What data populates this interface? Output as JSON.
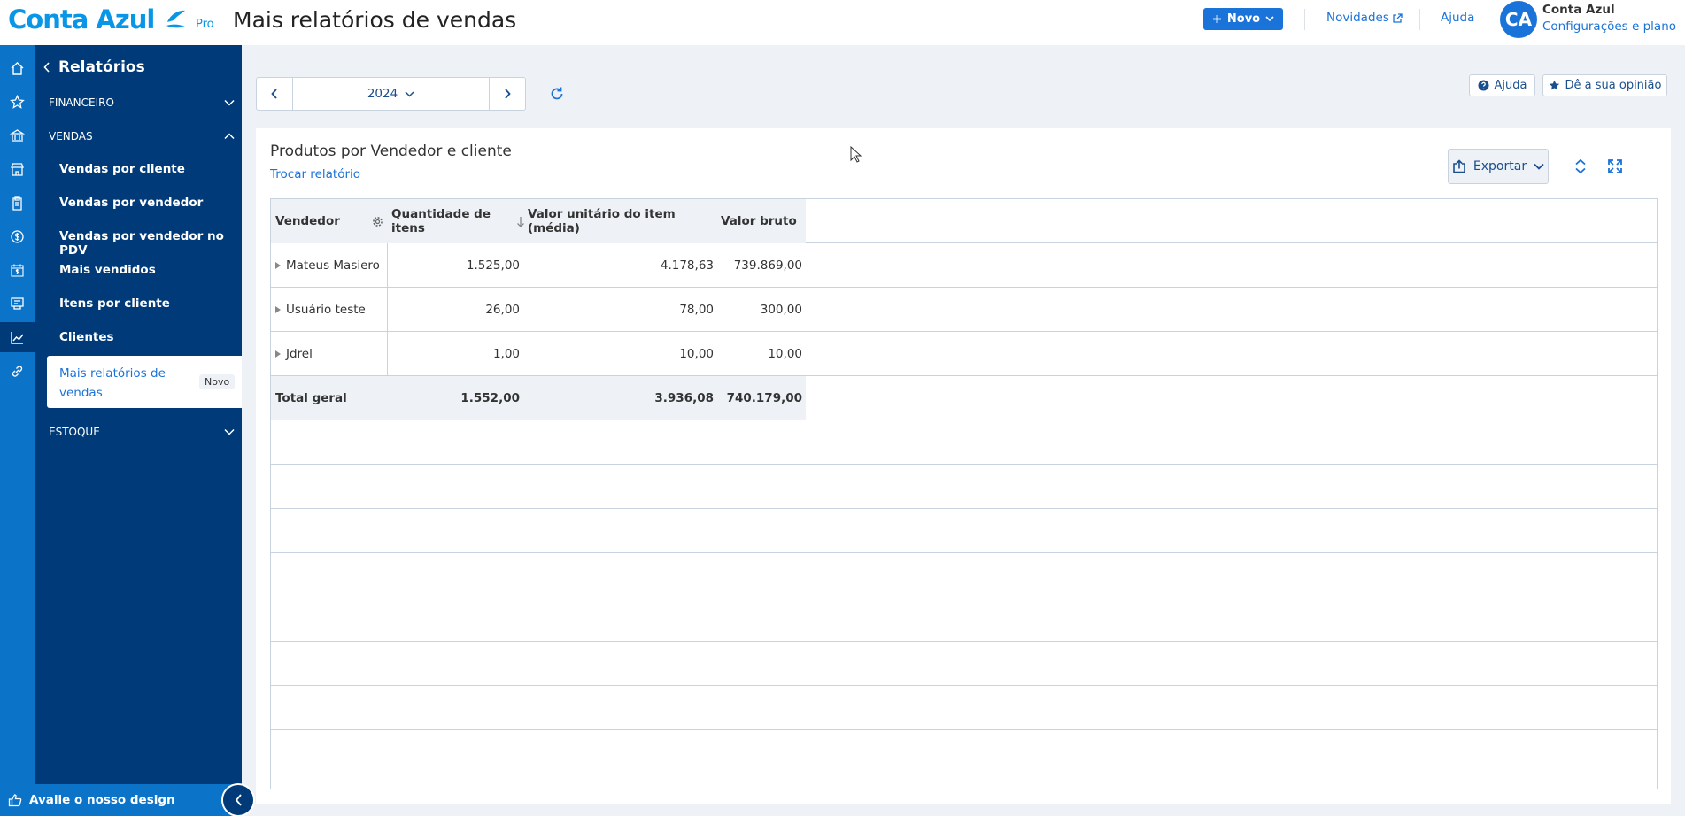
{
  "header": {
    "logo_text": "Conta Azul",
    "logo_badge": "Pro",
    "page_title": "Mais relatórios de vendas",
    "new_button": "Novo",
    "news_link": "Novidades",
    "help_link": "Ajuda",
    "avatar_initials": "CA",
    "user_name": "Conta Azul",
    "user_subtitle": "Configurações e plano"
  },
  "rail": {
    "items": [
      "home-icon",
      "star-icon",
      "bank-icon",
      "store-icon",
      "clipboard-icon",
      "dollar-icon",
      "calendar-dollar-icon",
      "register-icon",
      "chart-icon",
      "link-icon"
    ],
    "active": "chart-icon"
  },
  "sidebar": {
    "title": "Relatórios",
    "sections": {
      "financeiro": "FINANCEIRO",
      "vendas": "VENDAS",
      "estoque": "ESTOQUE"
    },
    "items": [
      "Vendas por cliente",
      "Vendas por vendedor",
      "Vendas por vendedor no PDV",
      "Mais vendidos",
      "Itens por cliente",
      "Clientes"
    ],
    "active_item": "Mais relatórios de vendas",
    "active_badge": "Novo",
    "footer": "Avalie o nosso design"
  },
  "toolbar": {
    "year": "2024",
    "help_button": "Ajuda",
    "feedback_button": "Dê a sua opinião"
  },
  "report": {
    "title": "Produtos por Vendedor e cliente",
    "switch_link": "Trocar relatório",
    "export_button": "Exportar",
    "columns": [
      "Vendedor",
      "Quantidade de itens",
      "Valor unitário do item (média)",
      "Valor bruto"
    ],
    "rows": [
      {
        "name": "Mateus Masiero",
        "qty": "1.525,00",
        "unit": "4.178,63",
        "gross": "739.869,00"
      },
      {
        "name": "Usuário teste",
        "qty": "26,00",
        "unit": "78,00",
        "gross": "300,00"
      },
      {
        "name": "Jdrel",
        "qty": "1,00",
        "unit": "10,00",
        "gross": "10,00"
      }
    ],
    "total": {
      "label": "Total geral",
      "qty": "1.552,00",
      "unit": "3.936,08",
      "gross": "740.179,00"
    }
  },
  "colors": {
    "brand": "#0a96e6",
    "primary": "#1a73d9",
    "sidebar": "#003a78",
    "rail": "#0b74c9"
  }
}
